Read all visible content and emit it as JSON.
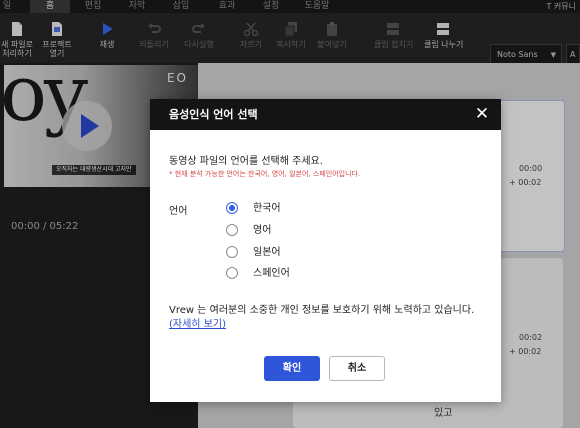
{
  "menu": {
    "items": [
      "일",
      "홈",
      "편집",
      "자막",
      "삽입",
      "효과",
      "설정",
      "도움말"
    ],
    "active": "홈",
    "right_text": "T 커뮤니"
  },
  "toolbar": {
    "open_file": "새 파일로\n처리하기",
    "open_project": "프로젝트\n열기",
    "play": "재생",
    "undo": "되돌리기",
    "redo": "다시실행",
    "cut": "자르기",
    "copy": "복사하기",
    "paste": "붙여넣기",
    "merge_clip": "클립 합치기",
    "split_clip": "클립 나누기",
    "font": "Noto Sans",
    "font_size": "A"
  },
  "video": {
    "big_text": "oy",
    "logo": "EO",
    "caption": "오직자는 대량생산시대 고지만",
    "time": "00:00 / 05:22"
  },
  "timeline": {
    "card1_start": "00:00",
    "card1_plus": "+ 00:02",
    "card2_start": "00:02",
    "card2_plus": "+ 00:02",
    "word": "있고"
  },
  "dialog": {
    "title": "음성인식 언어 선택",
    "close": "✕",
    "prompt": "동영상 파일의 언어를 선택해 주세요.",
    "notice": "* 현재 분석 가능한 언어는 한국어, 영어, 일본어, 스페인어입니다.",
    "language_label": "언어",
    "options": [
      "한국어",
      "영어",
      "일본어",
      "스페인어"
    ],
    "selected": "한국어",
    "privacy": "Vrew 는 여러분의 소중한 개인 정보를 보호하기 위해 노력하고 있습니다.",
    "privacy_link": "(자세히 보기)",
    "ok": "확인",
    "cancel": "취소"
  },
  "colors": {
    "accent": "#2f55d8",
    "notice": "#d64545",
    "header": "#141414"
  }
}
